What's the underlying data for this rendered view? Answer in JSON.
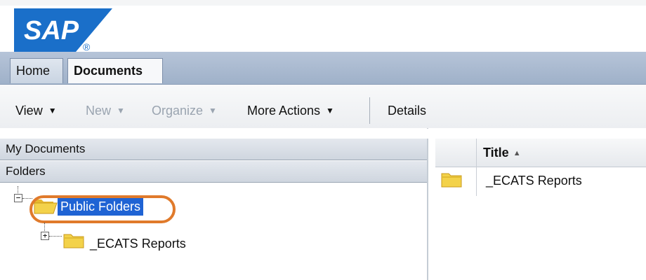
{
  "logo": {
    "text": "SAP",
    "mark": "®",
    "color": "#1a6fc9"
  },
  "tabs": [
    {
      "label": "Home",
      "active": false
    },
    {
      "label": "Documents",
      "active": true
    }
  ],
  "toolbar": {
    "view_label": "View",
    "new_label": "New",
    "organize_label": "Organize",
    "more_actions_label": "More Actions",
    "details_label": "Details",
    "caret": "▼"
  },
  "left_panel": {
    "my_documents": "My Documents",
    "folders": "Folders",
    "tree": {
      "root": {
        "label": "Public Folders",
        "expander": "−",
        "selected": true
      },
      "child": {
        "label": "_ECATS Reports",
        "expander": "+"
      }
    }
  },
  "right_panel": {
    "column_title": "Title",
    "sort_arrow": "▲",
    "rows": [
      {
        "title": "_ECATS Reports"
      }
    ]
  },
  "colors": {
    "selection": "#1f63d4",
    "highlight": "#e07a2b",
    "tabbar": "#9fb1c9",
    "folder": "#f3d24a"
  }
}
